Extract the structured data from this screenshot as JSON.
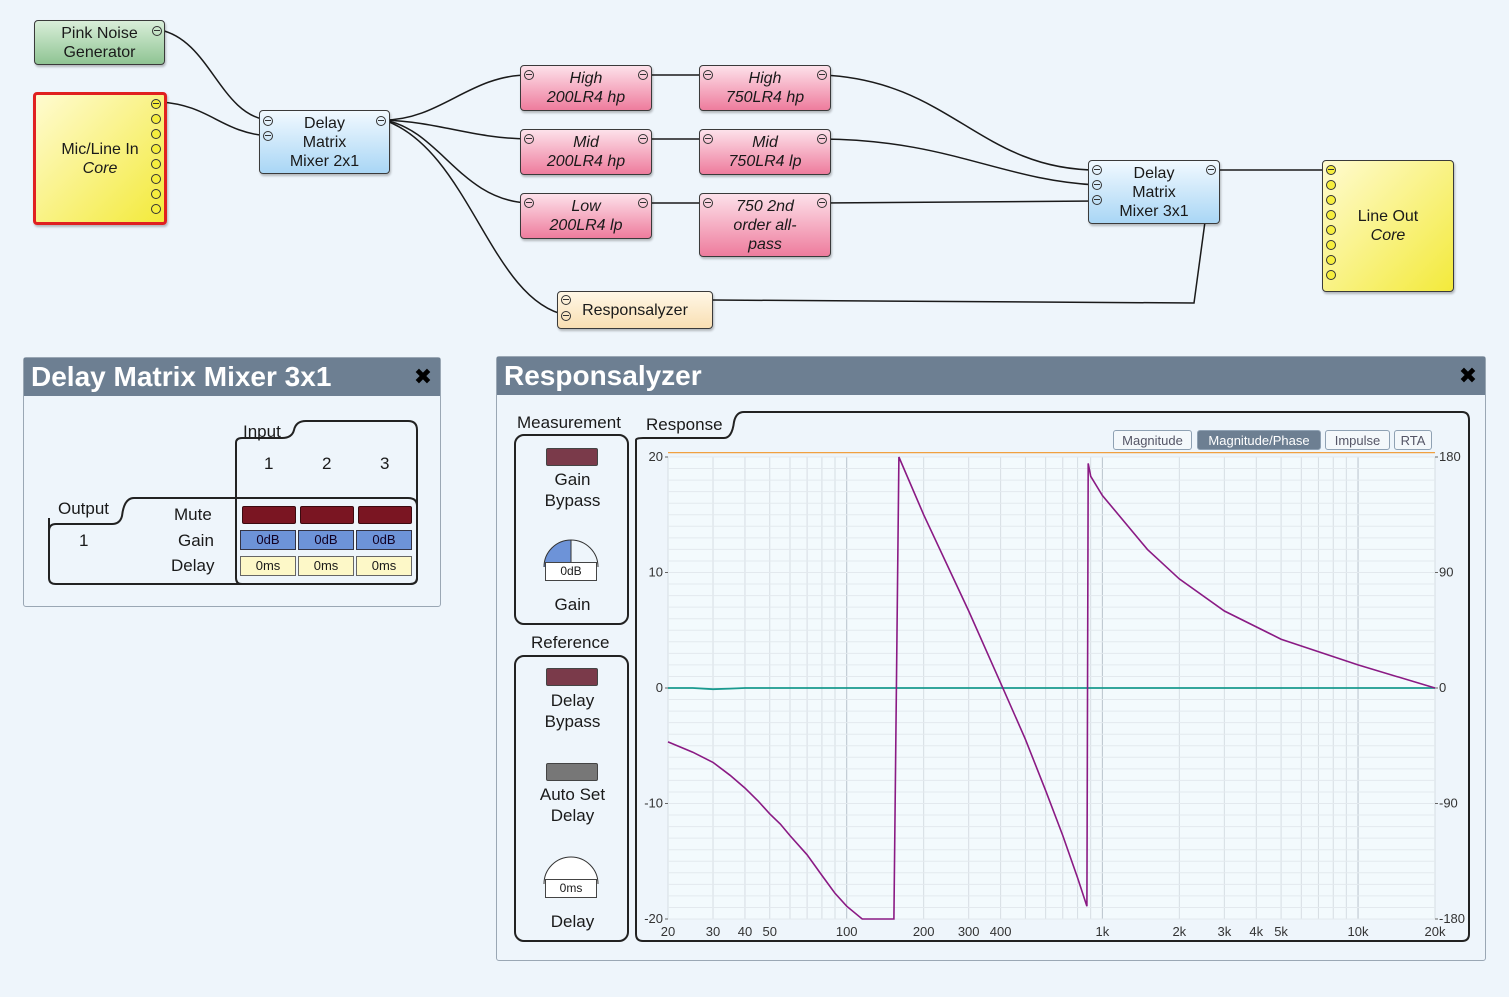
{
  "blocks": {
    "pink_noise": {
      "line1": "Pink Noise",
      "line2": "Generator"
    },
    "mic_line": {
      "line1": "Mic/Line In",
      "line2": "Core"
    },
    "dmm2x1": {
      "line1": "Delay",
      "line2": "Matrix",
      "line3": "Mixer 2x1"
    },
    "high_hp200": {
      "line1": "High",
      "line2": "200LR4 hp"
    },
    "high_hp750": {
      "line1": "High",
      "line2": "750LR4 hp"
    },
    "mid_hp200": {
      "line1": "Mid",
      "line2": "200LR4 hp"
    },
    "mid_lp750": {
      "line1": "Mid",
      "line2": "750LR4 lp"
    },
    "low_lp200": {
      "line1": "Low",
      "line2": "200LR4 lp"
    },
    "allpass750": {
      "line1": "750 2nd",
      "line2": "order all-",
      "line3": "pass"
    },
    "dmm3x1": {
      "line1": "Delay",
      "line2": "Matrix",
      "line3": "Mixer 3x1"
    },
    "line_out": {
      "line1": "Line Out",
      "line2": "Core"
    },
    "responsalyzer": {
      "line1": "Responsalyzer"
    }
  },
  "mixer_panel": {
    "title": "Delay Matrix Mixer 3x1",
    "close_icon": "close-icon",
    "input_label": "Input",
    "output_label": "Output",
    "inputs": [
      "1",
      "2",
      "3"
    ],
    "output_number": "1",
    "row_mute": "Mute",
    "row_gain": "Gain",
    "row_delay": "Delay",
    "gains": [
      "0dB",
      "0dB",
      "0dB"
    ],
    "delays": [
      "0ms",
      "0ms",
      "0ms"
    ]
  },
  "resp_panel": {
    "title": "Responsalyzer",
    "close_icon": "close-icon",
    "measurement_label": "Measurement",
    "gain_bypass": "Gain\nBypass",
    "gain_knob_value": "0dB",
    "gain_label": "Gain",
    "reference_label": "Reference",
    "delay_bypass": "Delay\nBypass",
    "auto_set_delay": "Auto Set\nDelay",
    "delay_knob_value": "0ms",
    "delay_label": "Delay",
    "response_label": "Response",
    "tabs": [
      "Magnitude",
      "Magnitude/Phase",
      "Impulse",
      "RTA"
    ],
    "active_tab": "Magnitude/Phase"
  },
  "colors": {
    "magnitude_line": "#1a9a8f",
    "phase_line": "#8a1a84",
    "top_line": "#f0a040",
    "mute_red": "#7a1522"
  },
  "chart_data": {
    "type": "line",
    "x_scale": "log",
    "xlim": [
      20,
      20000
    ],
    "ylim": [
      -20,
      20
    ],
    "y2lim": [
      -180,
      180
    ],
    "x_ticks": [
      {
        "v": 20,
        "label": "20"
      },
      {
        "v": 30,
        "label": "30"
      },
      {
        "v": 40,
        "label": "40"
      },
      {
        "v": 50,
        "label": "50"
      },
      {
        "v": 100,
        "label": "100"
      },
      {
        "v": 200,
        "label": "200"
      },
      {
        "v": 300,
        "label": "300"
      },
      {
        "v": 400,
        "label": "400"
      },
      {
        "v": 1000,
        "label": "1k"
      },
      {
        "v": 2000,
        "label": "2k"
      },
      {
        "v": 3000,
        "label": "3k"
      },
      {
        "v": 4000,
        "label": "4k"
      },
      {
        "v": 5000,
        "label": "5k"
      },
      {
        "v": 10000,
        "label": "10k"
      },
      {
        "v": 20000,
        "label": "20k"
      }
    ],
    "y_ticks": [
      {
        "v": 20,
        "label": "20"
      },
      {
        "v": 10,
        "label": "10"
      },
      {
        "v": 0,
        "label": "0"
      },
      {
        "v": -10,
        "label": "-10"
      },
      {
        "v": -20,
        "label": "-20"
      }
    ],
    "y2_ticks": [
      {
        "v": 180,
        "label": "180"
      },
      {
        "v": 90,
        "label": "90"
      },
      {
        "v": 0,
        "label": "0"
      },
      {
        "v": -90,
        "label": "-90"
      },
      {
        "v": -180,
        "label": "-180"
      }
    ],
    "series": [
      {
        "axis": "left",
        "color": "#1a9a8f",
        "x": [
          20,
          25,
          30,
          35,
          40,
          60,
          100,
          200,
          400,
          1000,
          5000,
          20000
        ],
        "y": [
          0,
          0,
          -0.1,
          -0.05,
          0,
          0,
          0,
          0,
          0,
          0,
          0,
          0
        ]
      },
      {
        "axis": "right",
        "color": "#8a1a84",
        "x": [
          20,
          25,
          30,
          35,
          40,
          45,
          50,
          55,
          60,
          70,
          80,
          90,
          100,
          115,
          130,
          145,
          150,
          153,
          160,
          200,
          300,
          400,
          500,
          600,
          700,
          800,
          870,
          880,
          900,
          1000,
          1500,
          2000,
          3000,
          5000,
          10000,
          20000
        ],
        "y": [
          -42,
          -50,
          -58,
          -68,
          -78,
          -88,
          -98,
          -106,
          -115,
          -130,
          -146,
          -160,
          -170,
          -188,
          -205,
          -226,
          -238,
          -248,
          180,
          135,
          60,
          4,
          -40,
          -80,
          -115,
          -148,
          -170,
          175,
          165,
          150,
          108,
          85,
          60,
          38,
          18,
          0
        ]
      },
      {
        "axis": "left",
        "color": "#f0a040",
        "x": [
          20,
          20000
        ],
        "y": [
          20.4,
          20.4
        ]
      }
    ]
  }
}
